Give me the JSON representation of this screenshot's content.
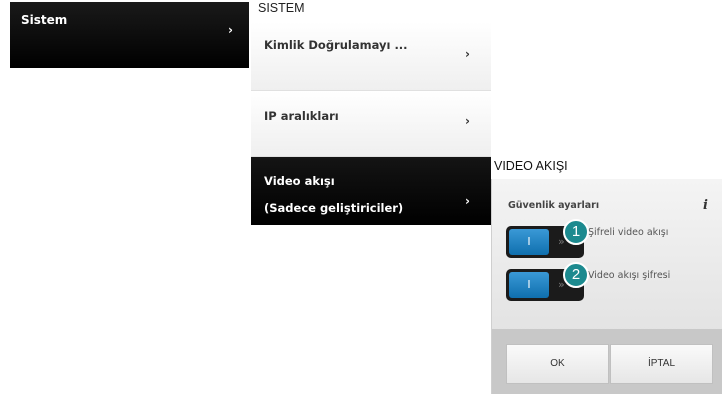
{
  "menu": {
    "item_label": "Sistem",
    "chevron": "›"
  },
  "sistem": {
    "title": "SISTEM",
    "rows": [
      {
        "label": "Kimlik Doğrulamayı ...",
        "chevron": "›"
      },
      {
        "label": "IP aralıkları",
        "chevron": "›"
      },
      {
        "label": "Video akışı",
        "label2": "(Sadece geliştiriciler)",
        "chevron": "›"
      }
    ]
  },
  "video": {
    "title": "VIDEO AKIŞI",
    "section_label": "Güvenlik ayarları",
    "info_icon": "i",
    "toggles": [
      {
        "label": "Şifreli video akışı",
        "state_text": "I",
        "badge": "1"
      },
      {
        "label": "Video akışı şifresi",
        "state_text": "I",
        "badge": "2"
      }
    ],
    "ok_label": "OK",
    "cancel_label": "İPTAL"
  },
  "colors": {
    "accent_blue": "#1a7fc1",
    "badge_teal": "#1c8a8f",
    "dark": "#000000"
  }
}
